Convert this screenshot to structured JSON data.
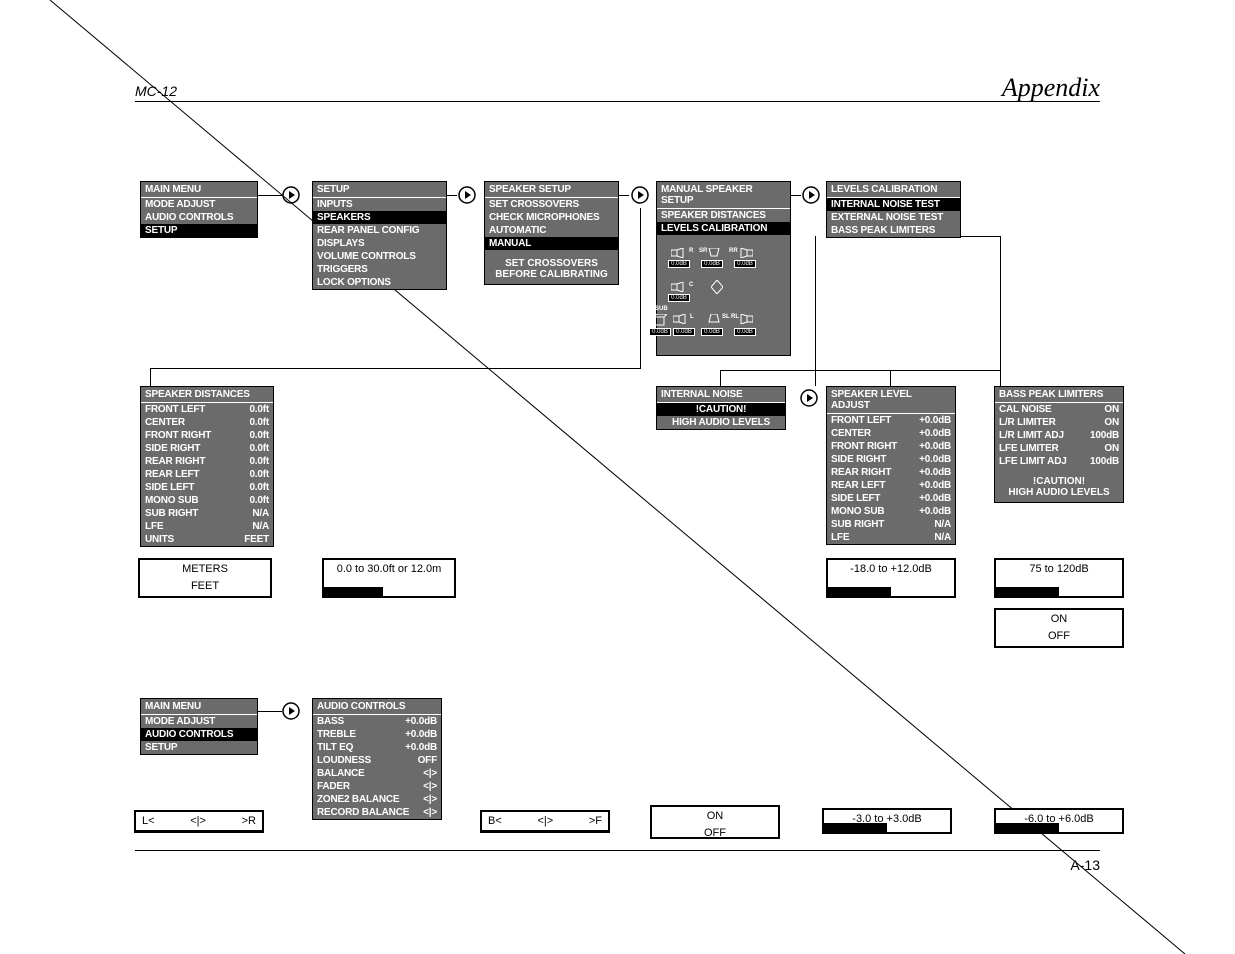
{
  "header": {
    "left": "MC-12",
    "right": "Appendix"
  },
  "footer": {
    "right": "A-13"
  },
  "row1": {
    "main_menu": {
      "title": "MAIN MENU",
      "items": [
        "MODE ADJUST",
        "AUDIO CONTROLS",
        "SETUP"
      ],
      "selected": "SETUP"
    },
    "setup": {
      "title": "SETUP",
      "items": [
        "INPUTS",
        "SPEAKERS",
        "REAR PANEL CONFIG",
        "DISPLAYS",
        "VOLUME CONTROLS",
        "TRIGGERS",
        "LOCK OPTIONS"
      ],
      "selected": "SPEAKERS"
    },
    "speaker_setup": {
      "title": "SPEAKER SETUP",
      "items": [
        "SET CROSSOVERS",
        "CHECK MICROPHONES",
        "AUTOMATIC",
        "MANUAL"
      ],
      "selected": "MANUAL",
      "note": [
        "SET CROSSOVERS",
        "BEFORE CALIBRATING"
      ]
    },
    "manual_speaker_setup": {
      "title": "MANUAL SPEAKER SETUP",
      "items": [
        "SPEAKER DISTANCES",
        "LEVELS CALIBRATION"
      ],
      "selected": "LEVELS CALIBRATION",
      "mini": {
        "labels": {
          "r": "R",
          "sr": "SR",
          "rr": "RR",
          "c": "C",
          "l": "L",
          "sl": "SL",
          "rl": "RL",
          "sub": "SUB"
        },
        "db": "0.0dB"
      }
    },
    "levels_calibration": {
      "title": "LEVELS CALIBRATION",
      "items": [
        "INTERNAL NOISE TEST",
        "EXTERNAL NOISE TEST",
        "BASS PEAK LIMITERS"
      ],
      "selected": "INTERNAL NOISE TEST"
    }
  },
  "row2": {
    "speaker_distances": {
      "title": "SPEAKER DISTANCES",
      "rows": [
        {
          "label": "FRONT LEFT",
          "value": "0.0ft"
        },
        {
          "label": "CENTER",
          "value": "0.0ft"
        },
        {
          "label": "FRONT RIGHT",
          "value": "0.0ft"
        },
        {
          "label": "SIDE RIGHT",
          "value": "0.0ft"
        },
        {
          "label": "REAR RIGHT",
          "value": "0.0ft"
        },
        {
          "label": "REAR LEFT",
          "value": "0.0ft"
        },
        {
          "label": "SIDE LEFT",
          "value": "0.0ft"
        },
        {
          "label": "MONO SUB",
          "value": "0.0ft"
        },
        {
          "label": "SUB RIGHT",
          "value": "N/A"
        },
        {
          "label": "LFE",
          "value": "N/A"
        },
        {
          "label": "UNITS",
          "value": "FEET"
        }
      ]
    },
    "units_opts": [
      "METERS",
      "FEET"
    ],
    "distance_range": "0.0 to 30.0ft or 12.0m",
    "internal_noise": {
      "title": "INTERNAL NOISE",
      "caution": "!CAUTION!",
      "warn": "HIGH AUDIO LEVELS"
    },
    "speaker_level_adjust": {
      "title": "SPEAKER LEVEL ADJUST",
      "rows": [
        {
          "label": "FRONT LEFT",
          "value": "+0.0dB"
        },
        {
          "label": "CENTER",
          "value": "+0.0dB"
        },
        {
          "label": "FRONT RIGHT",
          "value": "+0.0dB"
        },
        {
          "label": "SIDE RIGHT",
          "value": "+0.0dB"
        },
        {
          "label": "REAR RIGHT",
          "value": "+0.0dB"
        },
        {
          "label": "REAR LEFT",
          "value": "+0.0dB"
        },
        {
          "label": "SIDE LEFT",
          "value": "+0.0dB"
        },
        {
          "label": "MONO SUB",
          "value": "+0.0dB"
        },
        {
          "label": "SUB RIGHT",
          "value": "N/A"
        },
        {
          "label": "LFE",
          "value": "N/A"
        }
      ]
    },
    "level_range": "-18.0 to +12.0dB",
    "bass_peak_limiters": {
      "title": "BASS PEAK LIMITERS",
      "rows": [
        {
          "label": "CAL NOISE",
          "value": "ON"
        },
        {
          "label": "L/R LIMITER",
          "value": "ON"
        },
        {
          "label": "L/R LIMIT ADJ",
          "value": "100dB"
        },
        {
          "label": "LFE LIMITER",
          "value": "ON"
        },
        {
          "label": "LFE LIMIT ADJ",
          "value": "100dB"
        }
      ],
      "caution": "!CAUTION!",
      "warn": "HIGH AUDIO LEVELS"
    },
    "limit_range": "75 to 120dB",
    "onoff_opts": [
      "ON",
      "OFF"
    ]
  },
  "row3": {
    "main_menu": {
      "title": "MAIN MENU",
      "items": [
        "MODE ADJUST",
        "AUDIO CONTROLS",
        "SETUP"
      ],
      "selected": "AUDIO CONTROLS"
    },
    "audio_controls": {
      "title": "AUDIO CONTROLS",
      "rows": [
        {
          "label": "BASS",
          "value": "+0.0dB"
        },
        {
          "label": "TREBLE",
          "value": "+0.0dB"
        },
        {
          "label": "TILT EQ",
          "value": "+0.0dB"
        },
        {
          "label": "LOUDNESS",
          "value": "OFF"
        },
        {
          "label": "BALANCE",
          "value": "<|>"
        },
        {
          "label": "FADER",
          "value": "<|>"
        },
        {
          "label": "ZONE2 BALANCE",
          "value": "<|>"
        },
        {
          "label": "RECORD BALANCE",
          "value": "<|>"
        }
      ]
    },
    "lr_box": {
      "l": "L<",
      "c": "<|>",
      "r": ">R"
    },
    "bf_box": {
      "l": "B<",
      "c": "<|>",
      "r": ">F"
    },
    "onoff": [
      "ON",
      "OFF"
    ],
    "range3": "-3.0 to +3.0dB",
    "range6": "-6.0 to +6.0dB"
  }
}
